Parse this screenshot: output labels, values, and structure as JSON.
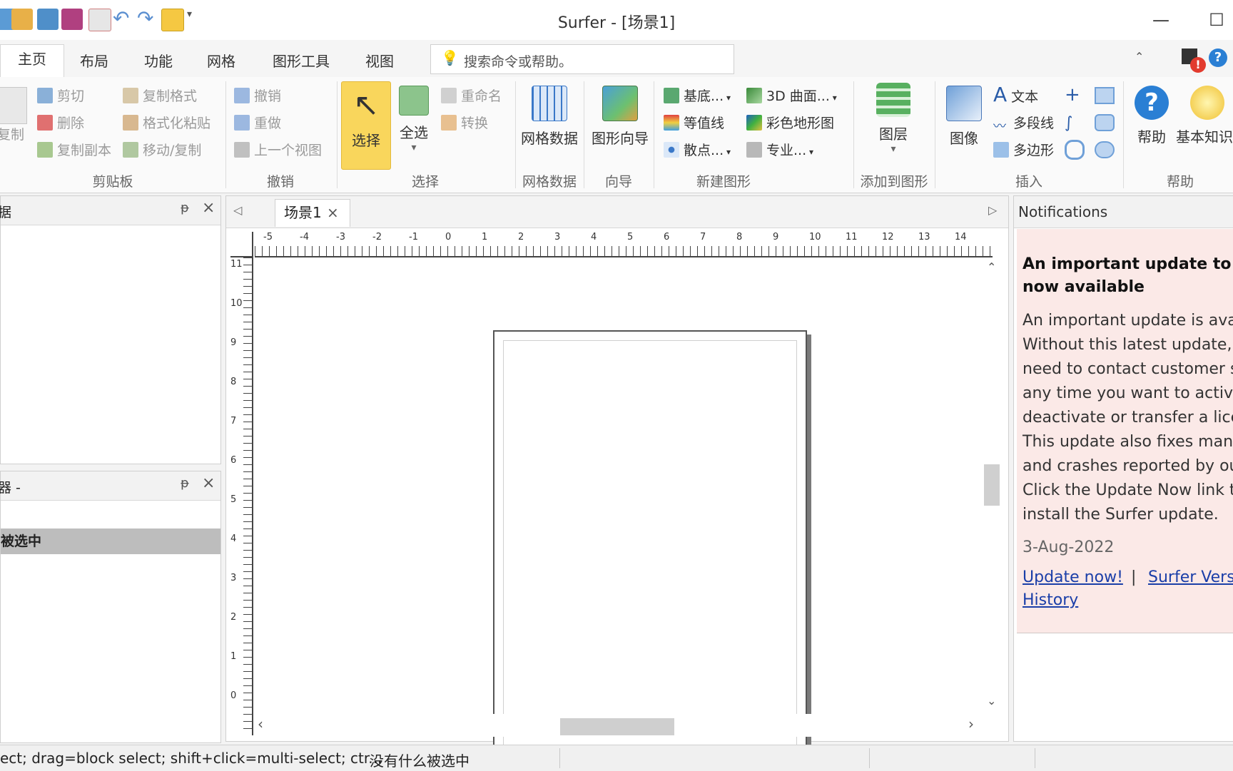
{
  "window": {
    "title": "Surfer - [场景1]"
  },
  "tabs": [
    "主页",
    "布局",
    "功能",
    "网格",
    "图形工具",
    "视图"
  ],
  "search": {
    "placeholder": "搜索命令或帮助。"
  },
  "ribbon": {
    "clipboard": {
      "label": "剪贴板",
      "copy": "复制",
      "cut": "剪切",
      "delete": "删除",
      "duplicate": "复制副本",
      "copy_format": "复制格式",
      "format_paste": "格式化粘贴",
      "move_copy": "移动/复制"
    },
    "undo": {
      "label": "撤销",
      "undo": "撤销",
      "redo": "重做",
      "prev_view": "上一个视图"
    },
    "select": {
      "label": "选择",
      "select": "选择",
      "select_all": "全选",
      "rename": "重命名",
      "convert": "转换"
    },
    "grid_data": {
      "label": "网格数据",
      "button": "网格数据"
    },
    "wizard": {
      "label": "向导",
      "button": "图形向导"
    },
    "new_map": {
      "label": "新建图形",
      "base": "基底...",
      "surface3d": "3D 曲面...",
      "contour": "等值线",
      "color_relief": "彩色地形图",
      "post": "散点...",
      "specialty": "专业..."
    },
    "add_to_map": {
      "label": "添加到图形",
      "layer": "图层"
    },
    "insert": {
      "label": "插入",
      "image": "图像",
      "text": "文本",
      "polyline": "多段线",
      "polygon": "多边形"
    },
    "help": {
      "label": "帮助",
      "help": "帮助",
      "basics": "基本知识"
    }
  },
  "left_panel_top": {
    "title": "据"
  },
  "left_panel_bottom": {
    "title": "器 -",
    "selection": "被选中"
  },
  "document": {
    "tab": "场景1",
    "ruler_top": [
      "-5",
      "-4",
      "-3",
      "-2",
      "-1",
      "0",
      "1",
      "2",
      "3",
      "4",
      "5",
      "6",
      "7",
      "8",
      "9",
      "10",
      "11",
      "12",
      "13",
      "14"
    ],
    "ruler_left": [
      "11",
      "10",
      "9",
      "8",
      "7",
      "6",
      "5",
      "4",
      "3",
      "2",
      "1",
      "0"
    ]
  },
  "notifications": {
    "title": "Notifications",
    "heading_line1": "An important update to Su",
    "heading_line2": "now available",
    "body_lines": [
      "An important update is ava",
      "Without this latest update,",
      "need to contact customer s",
      "any time you want to activa",
      "deactivate or transfer a lice",
      "This update also fixes many",
      "and crashes reported by ou",
      "Click the Update Now link t",
      "install the Surfer update."
    ],
    "date": "3-Aug-2022",
    "link_update": "Update now!",
    "separator": "|",
    "link_history_part1": "Surfer Vers",
    "link_history_part2": "History"
  },
  "status": {
    "hint": "ect; drag=block select; shift+click=multi-select; ctr...",
    "selection": "没有什么被选中"
  },
  "colors": {
    "accent": "#f5c842",
    "notification_bg": "#fbe9e7",
    "link": "#1a3ea8"
  }
}
